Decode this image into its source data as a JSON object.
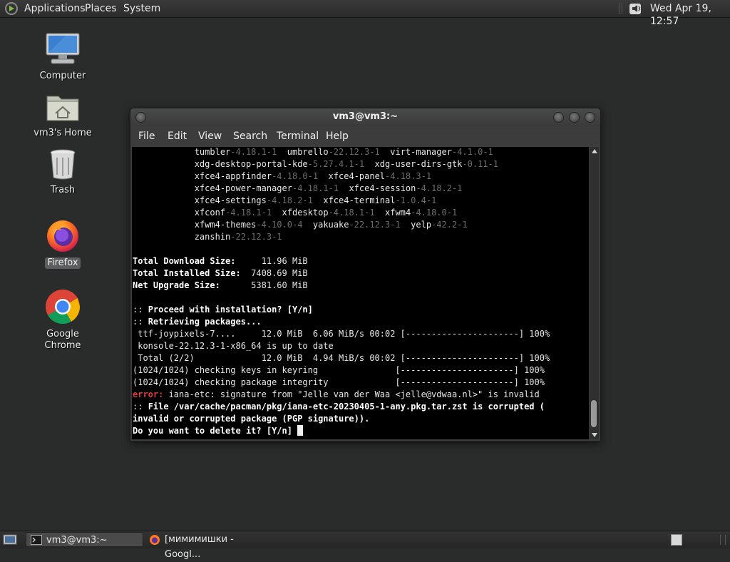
{
  "top_panel": {
    "menus": [
      "Applications",
      "Places",
      "System"
    ],
    "clock": "Wed Apr 19, 12:57"
  },
  "desktop": {
    "icons": [
      {
        "label": "Computer",
        "icon": "computer-icon"
      },
      {
        "label": "vm3's Home",
        "icon": "home-folder-icon"
      },
      {
        "label": "Trash",
        "icon": "trash-icon"
      },
      {
        "label": "Firefox",
        "icon": "firefox-icon"
      },
      {
        "label": "Google Chrome",
        "icon": "chrome-icon"
      }
    ]
  },
  "terminal": {
    "title": "vm3@vm3:~",
    "menu": [
      "File",
      "Edit",
      "View",
      "Search",
      "Terminal",
      "Help"
    ],
    "lines": [
      [
        {
          "t": "            tumbler"
        },
        {
          "t": "-4.18.1-1",
          "s": "g"
        },
        {
          "t": "  umbrello"
        },
        {
          "t": "-22.12.3-1",
          "s": "g"
        },
        {
          "t": "  virt-manager"
        },
        {
          "t": "-4.1.0-1",
          "s": "g"
        }
      ],
      [
        {
          "t": "            xdg-desktop-portal-kde"
        },
        {
          "t": "-5.27.4.1-1",
          "s": "g"
        },
        {
          "t": "  xdg-user-dirs-gtk"
        },
        {
          "t": "-0.11-1",
          "s": "g"
        }
      ],
      [
        {
          "t": "            xfce4-appfinder"
        },
        {
          "t": "-4.18.0-1",
          "s": "g"
        },
        {
          "t": "  xfce4-panel"
        },
        {
          "t": "-4.18.3-1",
          "s": "g"
        }
      ],
      [
        {
          "t": "            xfce4-power-manager"
        },
        {
          "t": "-4.18.1-1",
          "s": "g"
        },
        {
          "t": "  xfce4-session"
        },
        {
          "t": "-4.18.2-1",
          "s": "g"
        }
      ],
      [
        {
          "t": "            xfce4-settings"
        },
        {
          "t": "-4.18.2-1",
          "s": "g"
        },
        {
          "t": "  xfce4-terminal"
        },
        {
          "t": "-1.0.4-1",
          "s": "g"
        }
      ],
      [
        {
          "t": "            xfconf"
        },
        {
          "t": "-4.18.1-1",
          "s": "g"
        },
        {
          "t": "  xfdesktop"
        },
        {
          "t": "-4.18.1-1",
          "s": "g"
        },
        {
          "t": "  xfwm4"
        },
        {
          "t": "-4.18.0-1",
          "s": "g"
        }
      ],
      [
        {
          "t": "            xfwm4-themes"
        },
        {
          "t": "-4.10.0-4",
          "s": "g"
        },
        {
          "t": "  yakuake"
        },
        {
          "t": "-22.12.3-1",
          "s": "g"
        },
        {
          "t": "  yelp"
        },
        {
          "t": "-42.2-1",
          "s": "g"
        }
      ],
      [
        {
          "t": "            zanshin"
        },
        {
          "t": "-22.12.3-1",
          "s": "g"
        }
      ],
      [],
      [
        {
          "t": "Total Download Size:",
          "s": "b"
        },
        {
          "t": "     11.96 MiB"
        }
      ],
      [
        {
          "t": "Total Installed Size:",
          "s": "b"
        },
        {
          "t": "  7408.69 MiB"
        }
      ],
      [
        {
          "t": "Net Upgrade Size:",
          "s": "b"
        },
        {
          "t": "      5381.60 MiB"
        }
      ],
      [],
      [
        {
          "t": ":: "
        },
        {
          "t": "Proceed with installation? [Y/n]",
          "s": "b"
        }
      ],
      [
        {
          "t": ":: "
        },
        {
          "t": "Retrieving packages...",
          "s": "b"
        }
      ],
      [
        {
          "t": " ttf-joypixels-7....     12.0 MiB  6.06 MiB/s 00:02 [----------------------] 100%"
        }
      ],
      [
        {
          "t": " konsole-22.12.3-1-x86_64 is up to date"
        }
      ],
      [
        {
          "t": " Total (2/2)             12.0 MiB  4.94 MiB/s 00:02 [----------------------] 100%"
        }
      ],
      [
        {
          "t": "(1024/1024) checking keys in keyring               [----------------------] 100%"
        }
      ],
      [
        {
          "t": "(1024/1024) checking package integrity             [----------------------] 100%"
        }
      ],
      [
        {
          "t": "error:",
          "s": "err"
        },
        {
          "t": " iana-etc: signature from \"Jelle van der Waa <jelle@vdwaa.nl>\" is invalid"
        }
      ],
      [
        {
          "t": ":: "
        },
        {
          "t": "File /var/cache/pacman/pkg/iana-etc-20230405-1-any.pkg.tar.zst is corrupted (",
          "s": "b"
        }
      ],
      [
        {
          "t": "invalid or corrupted package (PGP signature)).",
          "s": "b"
        }
      ],
      [
        {
          "t": "Do you want to delete it? [Y/n] ",
          "s": "b"
        }
      ]
    ]
  },
  "taskbar": {
    "tasks": [
      {
        "label": "vm3@vm3:~",
        "icon": "terminal-icon",
        "active": true
      },
      {
        "label": "[мимимишки - Googl...",
        "icon": "firefox-icon",
        "active": false
      }
    ]
  }
}
